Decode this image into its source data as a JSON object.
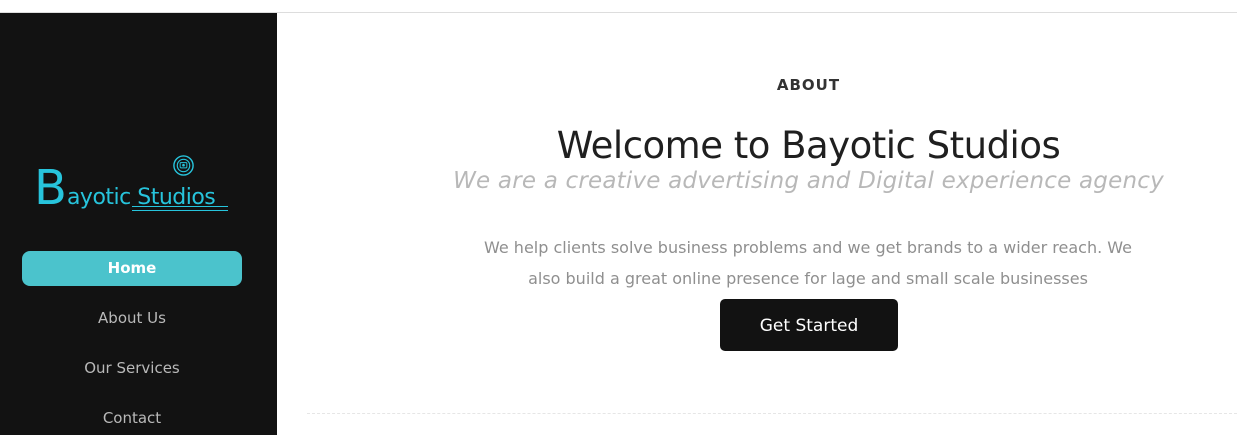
{
  "brand": {
    "logo_initial": "B",
    "logo_text": "ayotic Studios",
    "logo_color": "#27c4dc",
    "logo_badge_icon": "camera-badge-icon"
  },
  "sidebar": {
    "background": "#121212",
    "items": [
      {
        "label": "Home",
        "active": true
      },
      {
        "label": "About Us",
        "active": false
      },
      {
        "label": "Our Services",
        "active": false
      },
      {
        "label": "Contact",
        "active": false
      }
    ],
    "active_color": "#4bc3cc"
  },
  "hero": {
    "eyebrow": "ABOUT",
    "title": "Welcome to Bayotic Studios",
    "tagline": "We are a creative advertising and Digital experience agency",
    "description": "We help clients solve business problems and we get brands to a wider reach. We also build a great online presence for lage and small scale businesses",
    "cta_label": "Get Started"
  }
}
